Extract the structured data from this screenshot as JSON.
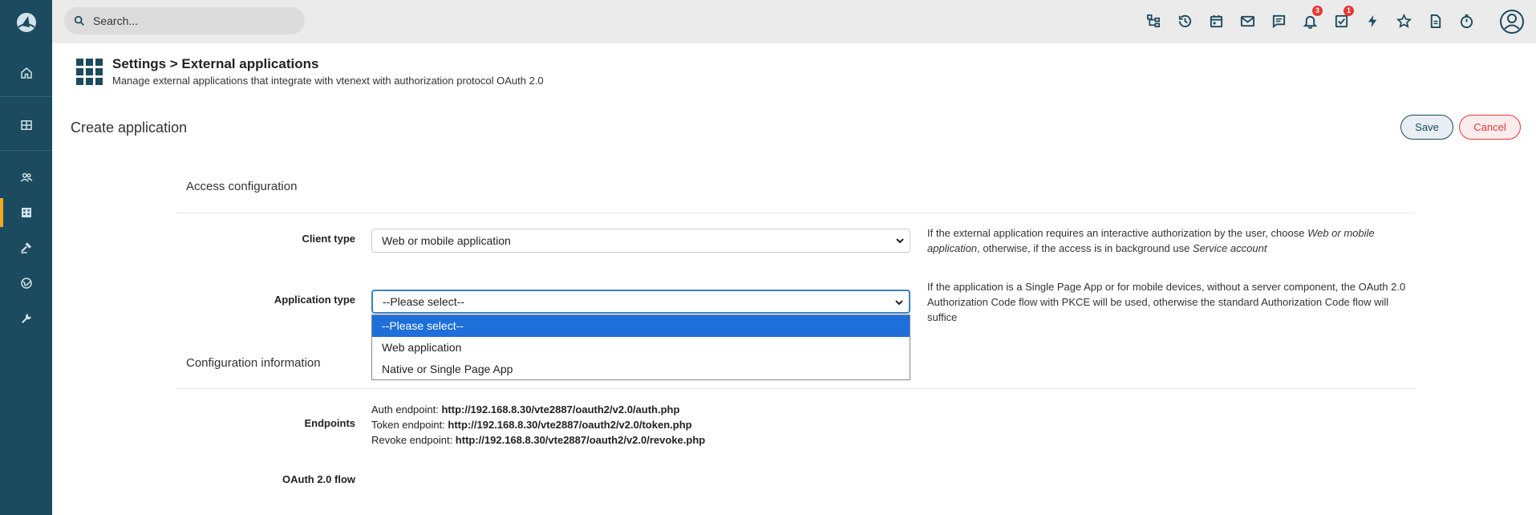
{
  "search": {
    "placeholder": "Search..."
  },
  "header": {
    "title": "Settings > External applications",
    "subtitle": "Manage external applications that integrate with vtenext with authorization protocol OAuth 2.0"
  },
  "form": {
    "title": "Create application",
    "save_label": "Save",
    "cancel_label": "Cancel"
  },
  "access": {
    "section_label": "Access configuration",
    "client_type_label": "Client type",
    "client_type_value": "Web or mobile application",
    "client_help_prefix": "If the external application requires an interactive authorization by the user, choose ",
    "client_help_em1": "Web or mobile application",
    "client_help_mid": ", otherwise, if the access is in background use ",
    "client_help_em2": "Service account",
    "app_type_label": "Application type",
    "app_type_value": "--Please select--",
    "app_help": "If the application is a Single Page App or for mobile devices, without a server component, the OAuth 2.0 Authorization Code flow with PKCE will be used, otherwise the standard Authorization Code flow will suffice",
    "dropdown_options": [
      "--Please select--",
      "Web application",
      "Native or Single Page App"
    ]
  },
  "config": {
    "section_label": "Configuration information",
    "endpoints_label": "Endpoints",
    "auth_label": "Auth endpoint: ",
    "auth_url": "http://192.168.8.30/vte2887/oauth2/v2.0/auth.php",
    "token_label": "Token endpoint: ",
    "token_url": "http://192.168.8.30/vte2887/oauth2/v2.0/token.php",
    "revoke_label": "Revoke endpoint: ",
    "revoke_url": "http://192.168.8.30/vte2887/oauth2/v2.0/revoke.php",
    "flow_label": "OAuth 2.0 flow"
  },
  "badges": {
    "notifications": "3",
    "tasks": "1"
  },
  "colors": {
    "sidebar": "#1c4a5e",
    "accent": "#f5a623",
    "badge": "#e53935",
    "selected_option": "#1e6fd9"
  },
  "icons": {
    "sidebar": [
      "logo-icon",
      "home-icon",
      "grid-icon",
      "users-icon",
      "building-icon",
      "gavel-icon",
      "globe-icon",
      "wrench-icon"
    ],
    "topbar": [
      "hierarchy-icon",
      "history-icon",
      "calendar-icon",
      "mail-icon",
      "chat-icon",
      "bell-icon",
      "task-check-icon",
      "lightning-icon",
      "star-icon",
      "document-icon",
      "timer-icon",
      "user-avatar-icon"
    ]
  }
}
